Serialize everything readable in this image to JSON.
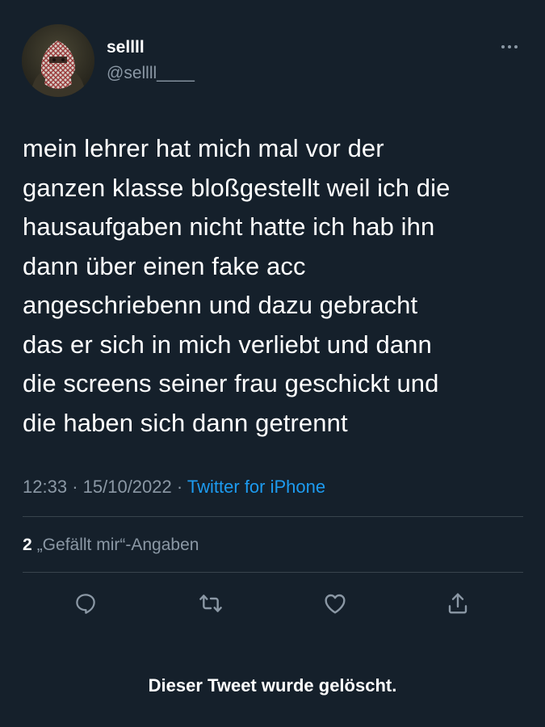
{
  "user": {
    "display_name": "sellll",
    "handle": "@sellll____"
  },
  "tweet": {
    "text": "mein lehrer hat mich mal vor der\nganzen klasse bloßgestellt weil ich die\nhausaufgaben nicht hatte ich hab ihn\ndann über einen fake acc\nangeschriebenn und dazu gebracht\ndas er sich in mich verliebt und dann\ndie screens seiner frau geschickt und\ndie haben sich dann getrennt",
    "time": "12:33",
    "separator": "·",
    "date": "15/10/2022",
    "source": "Twitter for iPhone"
  },
  "stats": {
    "likes_count": "2",
    "likes_label": "„Gefällt mir“-Angaben"
  },
  "actions": {
    "reply_icon": "reply-icon",
    "retweet_icon": "retweet-icon",
    "like_icon": "heart-icon",
    "share_icon": "share-icon"
  },
  "footer": {
    "deleted_notice": "Dieser Tweet wurde gelöscht."
  },
  "colors": {
    "background": "#15202b",
    "text": "#ffffff",
    "secondary": "#8b98a5",
    "link": "#1d9bf0",
    "divider": "#38444d"
  }
}
